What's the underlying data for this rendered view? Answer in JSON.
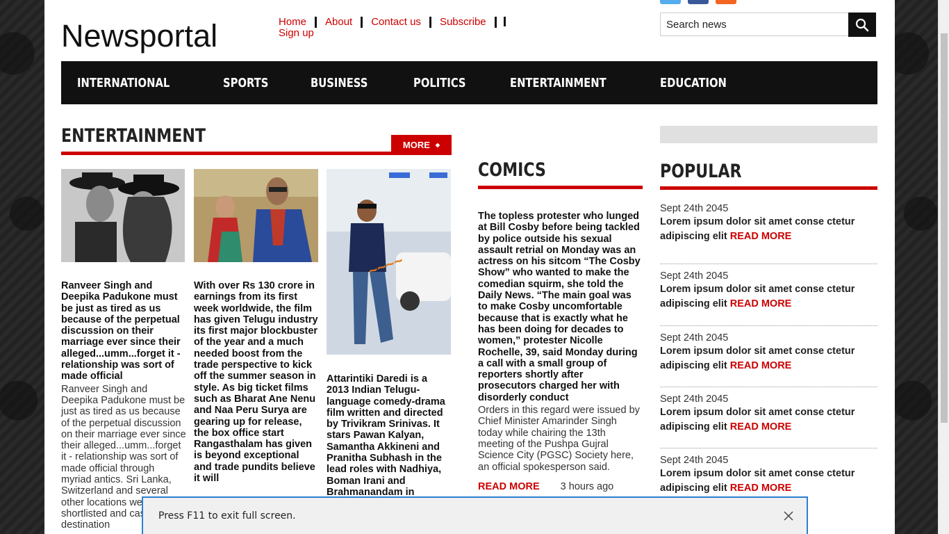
{
  "site": {
    "logo": "Newsportal"
  },
  "topnav": {
    "items": [
      "Home",
      "About",
      "Contact us",
      "Subscribe",
      "Sign up"
    ]
  },
  "search": {
    "placeholder": "Search news"
  },
  "mainnav": {
    "items": [
      "INTERNATIONAL",
      "SPORTS",
      "BUSINESS",
      "POLITICS",
      "ENTERTAINMENT",
      "EDUCATION"
    ]
  },
  "entertainment": {
    "title": "ENTERTAINMENT",
    "more_label": "MORE",
    "articles": [
      {
        "headline": "Ranveer Singh and Deepika Padukone must be just as tired as us because of the perpetual discussion on their marriage ever since their alleged...umm...forget it - relationship was sort of made official",
        "body": "Ranveer Singh and Deepika Padukone must be just as tired as us because of the perpetual discussion on their marriage ever since their alleged...umm...forget it - relationship was sort of made official through myriad antics. Sri Lanka, Switzerland and several other locations were shortlisted and cast as their destination"
      },
      {
        "headline": "With over Rs 130 crore in earnings from its first week worldwide, the film has given Telugu industry its first major blockbuster of the year and a much needed boost from the trade perspective to kick off the summer season in style. As big ticket films such as Bharat Ane Nenu and Naa Peru Surya are gearing up for release, the box office start Rangasthalam has given is beyond exceptional and trade pundits believe it will",
        "body": ""
      },
      {
        "headline": "Attarintiki Daredi is a 2013 Indian Telugu-language comedy-drama film written and directed by Trivikram Srinivas. It stars Pawan Kalyan, Samantha Akkineni and Pranitha Subhash in the lead roles with Nadhiya, Boman Irani and Brahmanandam in",
        "body": ""
      }
    ]
  },
  "comics": {
    "title": "COMICS",
    "headline": "The topless protester who lunged at Bill Cosby before being tackled by police outside his sexual assault retrial on Monday was an actress on his sitcom “The Cosby Show” who wanted to make the comedian squirm, she told the Daily News. “The main goal was to make Cosby uncomfortable because that is exactly what he has been doing for decades to women,” protester Nicolle Rochelle, 39, said Monday during a call with a small group of reporters shortly after prosecutors charged her with disorderly conduct",
    "body": "Orders in this regard were issued by Chief Minister Amarinder Singh today while chairing the 13th meeting of the Pushpa Gujral Science City (PGSC) Society here, an official spokesperson said.",
    "read_more": "READ MORE",
    "time_ago": "3 hours ago"
  },
  "popular": {
    "title": "POPULAR",
    "items": [
      {
        "date": "Sept 24th 2045",
        "text": "Lorem ipsum dolor sit amet conse ctetur adipiscing elit",
        "read_more": "READ MORE"
      },
      {
        "date": "Sept 24th 2045",
        "text": "Lorem ipsum dolor sit amet conse ctetur adipiscing elit",
        "read_more": "READ MORE"
      },
      {
        "date": "Sept 24th 2045",
        "text": "Lorem ipsum dolor sit amet conse ctetur adipiscing elit",
        "read_more": "READ MORE"
      },
      {
        "date": "Sept 24th 2045",
        "text": "Lorem ipsum dolor sit amet conse ctetur adipiscing elit",
        "read_more": "READ MORE"
      },
      {
        "date": "Sept 24th 2045",
        "text": "Lorem ipsum dolor sit amet conse ctetur adipiscing elit",
        "read_more": "READ MORE"
      }
    ]
  },
  "fullscreen_notice": {
    "text": "Press F11 to exit full screen."
  },
  "colors": {
    "accent": "#cc0000",
    "nav_bg": "#111111",
    "notice_border": "#2a7fd4"
  },
  "icons": {
    "search": "search-icon",
    "close": "close-icon"
  }
}
